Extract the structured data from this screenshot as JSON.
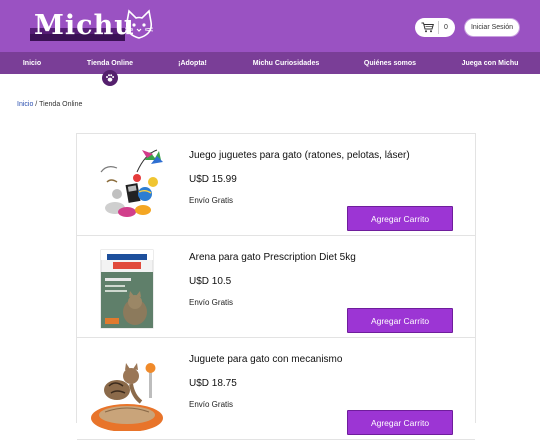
{
  "header": {
    "logo_text": "Michu",
    "cart_count": "0",
    "login_label": "Iniciar Sesión",
    "colors": {
      "header_bg": "#9a52c2",
      "nav_bg": "#7a3e97",
      "button": "#9c35d4"
    }
  },
  "nav": {
    "items": [
      {
        "label": "Inicio"
      },
      {
        "label": "Tienda Online"
      },
      {
        "label": "¡Adopta!"
      },
      {
        "label": "Michu Curiosidades"
      },
      {
        "label": "Quiénes somos"
      },
      {
        "label": "Juega con Michu"
      }
    ],
    "active_icon": "paw-icon"
  },
  "breadcrumb": {
    "home": "Inicio",
    "separator": " / ",
    "current": "Tienda Online"
  },
  "products": [
    {
      "title": "Juego juguetes para gato (ratones, pelotas, láser)",
      "price": "U$D  15.99",
      "shipping": "Envío Gratis",
      "button": "Agregar Carrito",
      "image_icon": "cat-toys-image"
    },
    {
      "title": "Arena para gato Prescription Diet 5kg",
      "price": "U$D  10.5",
      "shipping": "Envío Gratis",
      "button": "Agregar Carrito",
      "image_icon": "cat-food-bag-image"
    },
    {
      "title": "Juguete para gato con mecanismo",
      "price": "U$D  18.75",
      "shipping": "Envío Gratis",
      "button": "Agregar Carrito",
      "image_icon": "cat-scratcher-image"
    }
  ]
}
